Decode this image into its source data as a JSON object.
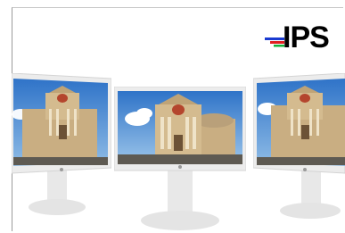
{
  "logo": {
    "text": "IPS",
    "stripe_colors": [
      "#1a3bd1",
      "#e02020",
      "#14b33a"
    ]
  },
  "monitors": [
    {
      "name": "left-monitor",
      "view": "angled-left"
    },
    {
      "name": "center-monitor",
      "view": "front"
    },
    {
      "name": "right-monitor",
      "view": "angled-right"
    }
  ],
  "colors": {
    "sky_top": "#2f73c8",
    "sky_bottom": "#8fbce6",
    "building": "#cdb48a",
    "bezel": "#ececec",
    "stand": "#e6e6e6"
  }
}
